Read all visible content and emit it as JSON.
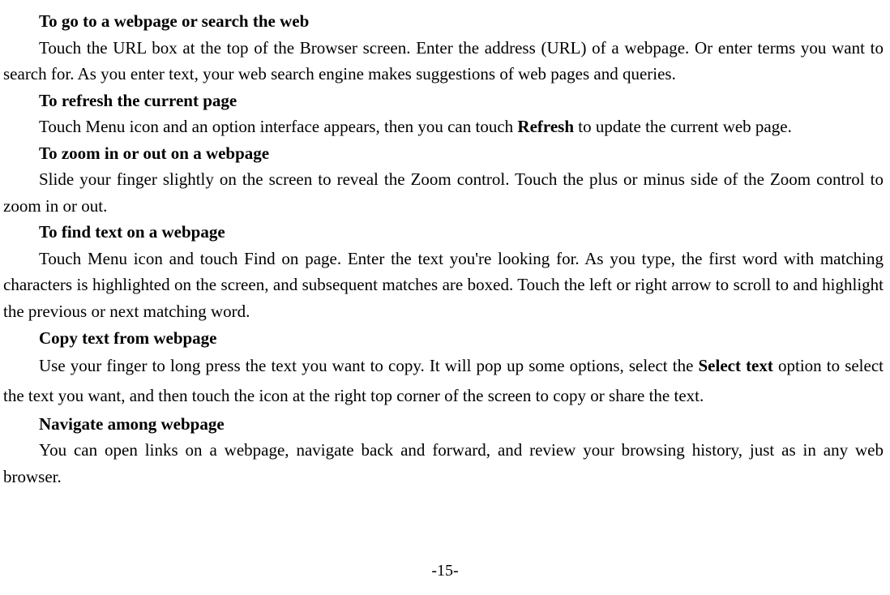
{
  "sections": [
    {
      "heading": "To go to a webpage or search the web",
      "body_before": "Touch the URL box at the top of the Browser screen. Enter the address (URL) of a webpage. Or enter terms you want to search for. As you enter text, your web search engine makes suggestions of web pages and queries.",
      "bold_inline": "",
      "body_after": ""
    },
    {
      "heading": "To refresh the current page",
      "body_before": "Touch Menu icon and an option interface appears, then you can touch ",
      "bold_inline": "Refresh",
      "body_after": " to update the current web page."
    },
    {
      "heading": "To zoom in or out on a webpage",
      "body_before": "Slide your finger slightly on the screen to reveal the Zoom control. Touch the plus or minus side of the Zoom control to zoom in or out.",
      "bold_inline": "",
      "body_after": ""
    },
    {
      "heading": "To find text on a webpage",
      "body_before": "Touch Menu icon and touch Find on page. Enter the text you're looking for. As you type, the first word with matching characters is highlighted on the screen, and subsequent matches are boxed. Touch the left or right arrow to scroll to and highlight the previous or next matching word.",
      "bold_inline": "",
      "body_after": ""
    },
    {
      "heading": "Copy text from webpage",
      "body_before": "Use your finger to long press the text you want to copy. It will pop up some options, select the ",
      "bold_inline": "Select text",
      "body_after": " option to select the text you want, and then touch the icon at the right top corner of the screen to copy or share the text."
    },
    {
      "heading": "Navigate among webpage",
      "body_before": "You can open links on a webpage, navigate back and forward, and review your browsing history, just as in any web browser.",
      "bold_inline": "",
      "body_after": ""
    }
  ],
  "page_number": "-15-"
}
